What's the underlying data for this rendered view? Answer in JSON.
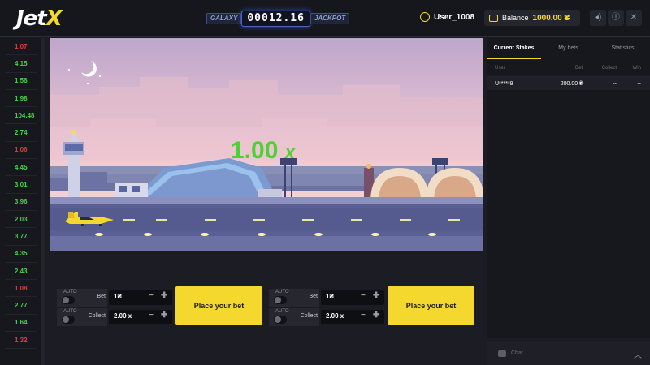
{
  "header": {
    "logo": "Jet",
    "logo_accent": "X",
    "jackpot_left": "GALAXY",
    "jackpot_value": "00012.16",
    "jackpot_right": "JACKPOT",
    "username": "User_1008",
    "balance_label": "Balance",
    "balance_amount": "1000.00 ₴"
  },
  "history": [
    {
      "value": "1.07",
      "status": "red"
    },
    {
      "value": "4.15",
      "status": "green"
    },
    {
      "value": "1.56",
      "status": "green"
    },
    {
      "value": "1.98",
      "status": "green"
    },
    {
      "value": "104.48",
      "status": "green"
    },
    {
      "value": "2.74",
      "status": "green"
    },
    {
      "value": "1.06",
      "status": "red"
    },
    {
      "value": "4.45",
      "status": "green"
    },
    {
      "value": "3.01",
      "status": "green"
    },
    {
      "value": "3.96",
      "status": "green"
    },
    {
      "value": "2.03",
      "status": "green"
    },
    {
      "value": "3.77",
      "status": "green"
    },
    {
      "value": "4.35",
      "status": "green"
    },
    {
      "value": "2.43",
      "status": "green"
    },
    {
      "value": "1.08",
      "status": "red"
    },
    {
      "value": "2.77",
      "status": "green"
    },
    {
      "value": "1.64",
      "status": "green"
    },
    {
      "value": "1.32",
      "status": "red"
    }
  ],
  "game": {
    "multiplier": "1.00",
    "multiplier_suffix": "x"
  },
  "bet_panels": [
    {
      "auto": "AUTO",
      "bet_label": "Bet",
      "bet_value": "1₴",
      "auto2": "AUTO",
      "collect_label": "Collect",
      "collect_value": "2.00 x",
      "button": "Place your bet"
    },
    {
      "auto": "AUTO",
      "bet_label": "Bet",
      "bet_value": "1₴",
      "auto2": "AUTO",
      "collect_label": "Collect",
      "collect_value": "2.00 x",
      "button": "Place your bet"
    }
  ],
  "right_panel": {
    "tabs": [
      "Current Stakes",
      "My bets",
      "Statistics"
    ],
    "columns": [
      "User",
      "Bet",
      "Collect",
      "Win"
    ],
    "rows": [
      {
        "user": "U*****9",
        "bet": "200.00 ₴",
        "collect": "--",
        "win": "--"
      }
    ],
    "chat_label": "Chat"
  },
  "colors": {
    "accent": "#f5d82d",
    "win_green": "#45d34a",
    "loss_red": "#e23a3a",
    "multiplier_green": "#4cd236"
  }
}
